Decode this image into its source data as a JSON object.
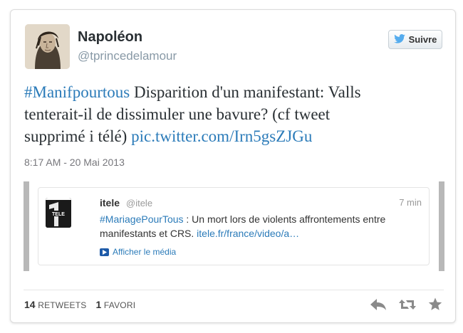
{
  "author": {
    "display_name": "Napoléon",
    "handle": "@tprincedelamour",
    "follow_label": "Suivre"
  },
  "tweet": {
    "hashtag": "#Manifpourtous",
    "text_line1": " Disparition d'un manifestant: Valls",
    "text_line2": "tenterait-il de dissimuler une bavure? (cf tweet",
    "text_line3": "supprimé i télé) ",
    "link": "pic.twitter.com/Irn5gsZJGu",
    "timestamp": "8:17 AM - 20 Mai 2013"
  },
  "embedded": {
    "avatar_text": "TELE",
    "name": "itele",
    "handle": "@itele",
    "time": "7 min",
    "hashtag": "#MariagePourTous",
    "text_part1": " : Un mort lors de violents affrontements entre",
    "text_part2": "manifestants et CRS. ",
    "link": "itele.fr/france/video/a…",
    "media_label": "Afficher le média"
  },
  "stats": {
    "retweets_count": "14",
    "retweets_label": "RETWEETS",
    "favorites_count": "1",
    "favorites_label": "FAVORI"
  },
  "icons": {
    "reply": "reply-icon",
    "retweet": "retweet-icon",
    "favorite": "star-icon",
    "twitter": "twitter-bird-icon"
  },
  "colors": {
    "link": "#2b7bb9",
    "twitter_blue": "#55acee"
  }
}
